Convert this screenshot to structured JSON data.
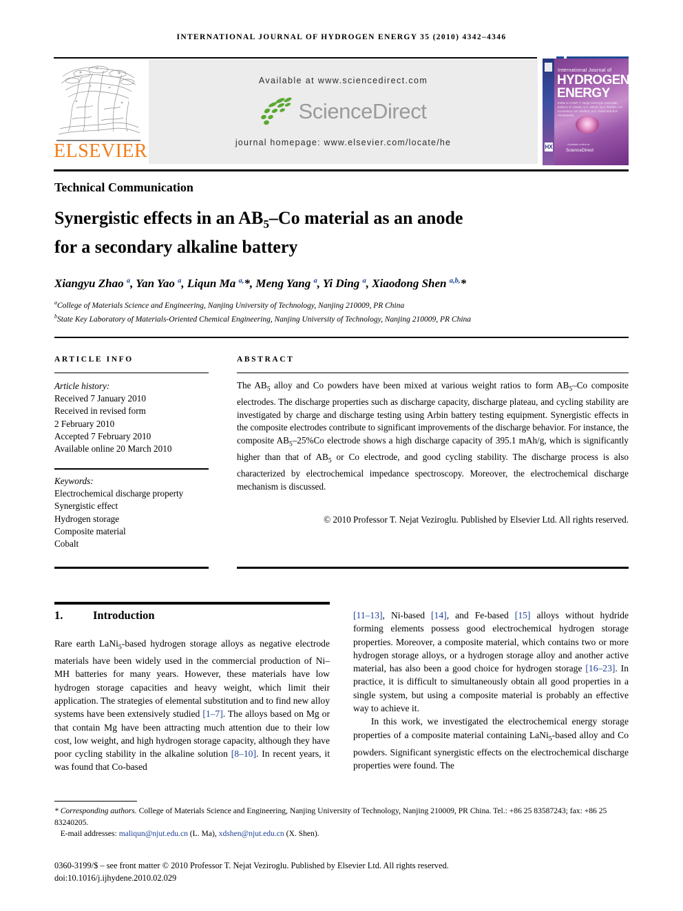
{
  "running_head": "INTERNATIONAL JOURNAL OF HYDROGEN ENERGY 35 (2010) 4342–4346",
  "header": {
    "publisher_name": "ELSEVIER",
    "available_at": "Available at www.sciencedirect.com",
    "sciencedirect_wordmark": "ScienceDirect",
    "journal_homepage": "journal homepage: www.elsevier.com/locate/he",
    "cover": {
      "top_line": "International Journal of",
      "title_line1": "HYDROGEN",
      "title_line2": "ENERGY",
      "editors": "Editor-in-Chief: T. Nejat Veziroglu   Associate Editors: D. Hissel, S.A. Sherif, M.A. Rosen, A.P. Kuznetsov, Ian Stafford, S.A. Gardi and B.K. Venkatesha",
      "sciencedirect_note": "Available online at",
      "sciencedirect_label": "ScienceDirect",
      "hx_badge": "HX"
    }
  },
  "article": {
    "type_label": "Technical Communication",
    "title_line1_pre": "Synergistic effects in an AB",
    "title_line1_sub": "5",
    "title_line1_post": "–Co material as an anode",
    "title_line2": "for a secondary alkaline battery",
    "authors_html": "Xiangyu Zhao <sup>a</sup>, Yan Yao <sup>a</sup>, Liqun Ma <sup>a,</sup>*, Meng Yang <sup>a</sup>, Yi Ding <sup>a</sup>, Xiaodong Shen <sup>a,b,</sup>*",
    "affiliation_a": "College of Materials Science and Engineering, Nanjing University of Technology, Nanjing 210009, PR China",
    "affiliation_b": "State Key Laboratory of Materials-Oriented Chemical Engineering, Nanjing University of Technology, Nanjing 210009, PR China",
    "affiliation_a_marker": "a",
    "affiliation_b_marker": "b"
  },
  "info": {
    "article_info_label": "ARTICLE INFO",
    "abstract_label": "ABSTRACT",
    "history_heading": "Article history:",
    "history": [
      "Received 7 January 2010",
      "Received in revised form",
      "2 February 2010",
      "Accepted 7 February 2010",
      "Available online 20 March 2010"
    ],
    "keywords_heading": "Keywords:",
    "keywords": [
      "Electrochemical discharge property",
      "Synergistic effect",
      "Hydrogen storage",
      "Composite material",
      "Cobalt"
    ]
  },
  "abstract": {
    "text_html": "The AB<sub>5</sub> alloy and Co powders have been mixed at various weight ratios to form AB<sub>5</sub>–Co composite electrodes. The discharge properties such as discharge capacity, discharge plateau, and cycling stability are investigated by charge and discharge testing using Arbin battery testing equipment. Synergistic effects in the composite electrodes contribute to significant improvements of the discharge behavior. For instance, the composite AB<sub>5</sub>–25%Co electrode shows a high discharge capacity of 395.1&nbsp;mAh/g, which is significantly higher than that of AB<sub>5</sub> or Co electrode, and good cycling stability. The discharge process is also characterized by electrochemical impedance spectroscopy. Moreover, the electrochemical discharge mechanism is discussed.",
    "copyright": "© 2010 Professor T. Nejat Veziroglu. Published by Elsevier Ltd. All rights reserved."
  },
  "body": {
    "section_number": "1.",
    "section_title": "Introduction",
    "left_column_html": "Rare earth LaNi<sub>5</sub>-based hydrogen storage alloys as negative electrode materials have been widely used in the commercial production of Ni–MH batteries for many years. However, these materials have low hydrogen storage capacities and heavy weight, which limit their application. The strategies of elemental substitution and to find new alloy systems have been extensively studied <span class=\"ref\">[1–7]</span>. The alloys based on Mg or that contain Mg have been attracting much attention due to their low cost, low weight, and high hydrogen storage capacity, although they have poor cycling stability in the alkaline solution <span class=\"ref\">[8–10]</span>. In recent years, it was found that Co-based",
    "right_column_html": "<span class=\"ref\">[11–13]</span>, Ni-based <span class=\"ref\">[14]</span>, and Fe-based <span class=\"ref\">[15]</span> alloys without hydride forming elements possess good electrochemical hydrogen storage properties. Moreover, a composite material, which contains two or more hydrogen storage alloys, or a hydrogen storage alloy and another active material, has also been a good choice for hydrogen storage <span class=\"ref\">[16–23]</span>. In practice, it is difficult to simultaneously obtain all good properties in a single system, but using a composite material is probably an effective way to achieve it.<br><span class=\"indent\" style=\"display:inline\">&nbsp;&nbsp;&nbsp;&nbsp;In this work, we investigated the electrochemical energy storage properties of a composite material containing LaNi<sub>5</sub>-based alloy and Co powders. Significant synergistic effects on the electrochemical discharge properties were found. The</span>"
  },
  "footnotes": {
    "corresponding_html": "<span class=\"ital\">* Corresponding authors.</span> College of Materials Science and Engineering, Nanjing University of Technology, Nanjing 210009, PR China. Tel.: +86 25 83587243; fax: +86 25 83240205.",
    "emails_html": "&nbsp;&nbsp;&nbsp;E-mail addresses: <span class=\"email\">maliqun@njut.edu.cn</span> (L. Ma), <span class=\"email\">xdshen@njut.edu.cn</span> (X. Shen).",
    "issn_line": "0360-3199/$ – see front matter © 2010 Professor T. Nejat Veziroglu. Published by Elsevier Ltd. All rights reserved.",
    "doi_line": "doi:10.1016/j.ijhydene.2010.02.029"
  },
  "colors": {
    "elsevier_orange": "#f07d1a",
    "sciencedirect_green": "#5aa832",
    "sciencedirect_grey": "#9a9a9a",
    "link_blue": "#1c3f94",
    "rule_blue": "#1c4a93",
    "panel_grey": "#ececec"
  }
}
